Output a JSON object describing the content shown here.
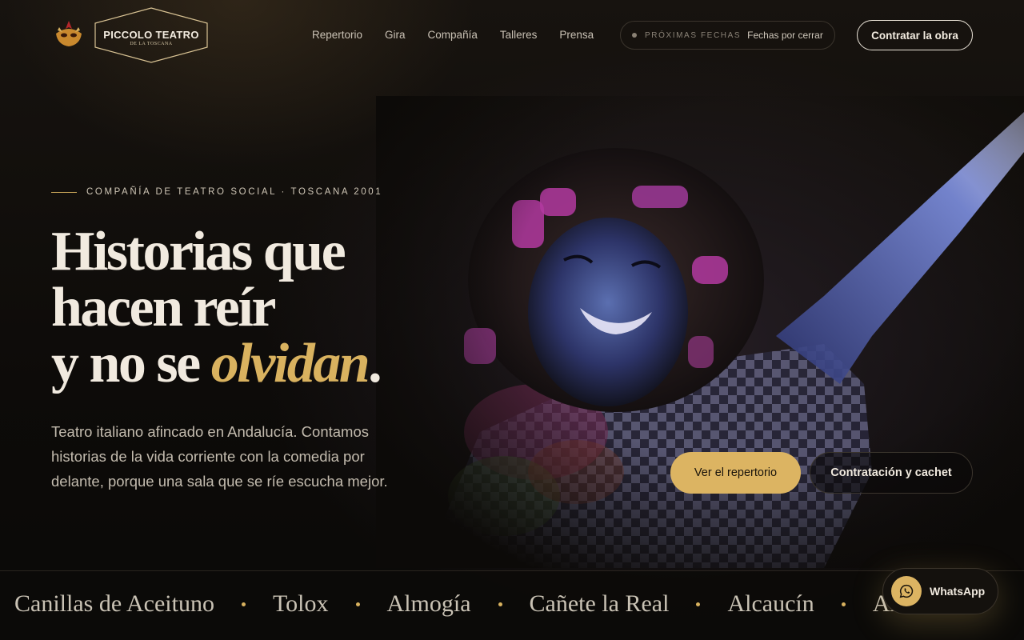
{
  "brand": {
    "name": "PICCOLO TEATRO",
    "subtitle": "DE LA TOSCANA",
    "accent": "#d9b25f"
  },
  "nav": {
    "items": [
      "Repertorio",
      "Gira",
      "Compañía",
      "Talleres",
      "Prensa"
    ]
  },
  "dates": {
    "label": "PRÓXIMAS FECHAS",
    "value": "Fechas por cerrar"
  },
  "header_cta": "Contratar la obra",
  "hero": {
    "eyebrow": "COMPAÑÍA DE TEATRO SOCIAL · TOSCANA 2001",
    "headline_1": "Historias que",
    "headline_2": "hacen reír",
    "headline_3_pre": "y no se ",
    "headline_3_em": "olvidan",
    "headline_3_post": ".",
    "lede": "Teatro italiano afincado en Andalucía. Contamos historias de la vida corriente con la comedia por delante, porque una sala que se ríe escucha mejor.",
    "primary_button": "Ver el repertorio",
    "secondary_button": "Contratación y cachet"
  },
  "marquee": {
    "towns": [
      "Canillas de Aceituno",
      "Tolox",
      "Almogía",
      "Cañete la Real",
      "Alcaucín",
      "Arriate"
    ]
  },
  "whatsapp": {
    "label": "WhatsApp",
    "icon": "whatsapp-icon"
  }
}
